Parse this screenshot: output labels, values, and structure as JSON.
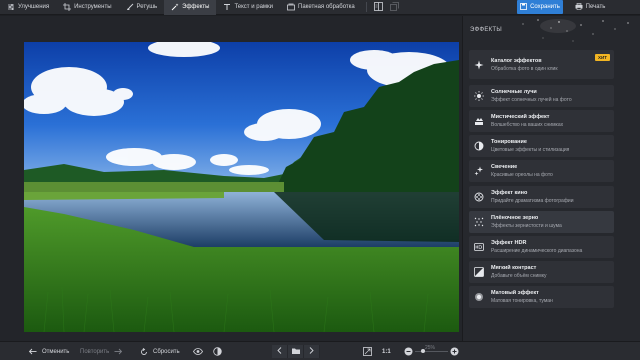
{
  "toolbar": {
    "tabs": [
      {
        "label": "Улучшения",
        "icon": "sliders-icon"
      },
      {
        "label": "Инструменты",
        "icon": "crop-icon"
      },
      {
        "label": "Ретушь",
        "icon": "brush-icon"
      },
      {
        "label": "Эффекты",
        "icon": "magic-wand-icon",
        "active": true
      },
      {
        "label": "Текст и рамки",
        "icon": "text-icon"
      },
      {
        "label": "Пакетная обработка",
        "icon": "batch-icon"
      }
    ],
    "save_label": "Сохранить",
    "print_label": "Печать"
  },
  "panel": {
    "title": "ЭФФЕКТЫ",
    "catalog": {
      "title": "Каталог эффектов",
      "subtitle": "Обработка фото в один клик",
      "badge": "ХИТ",
      "icon": "sparkle-icon"
    },
    "effects": [
      {
        "title": "Солнечные лучи",
        "subtitle": "Эффект солнечных лучей на фото",
        "icon": "sun-icon"
      },
      {
        "title": "Мистический эффект",
        "subtitle": "Волшебство на ваших снимках",
        "icon": "mystic-icon"
      },
      {
        "title": "Тонирование",
        "subtitle": "Цветовые эффекты и стилизация",
        "icon": "toning-icon"
      },
      {
        "title": "Свечение",
        "subtitle": "Красивые ореолы на фото",
        "icon": "glow-icon"
      },
      {
        "title": "Эффект кино",
        "subtitle": "Придайте драматизма фотографии",
        "icon": "film-icon"
      },
      {
        "title": "Плёночное зерно",
        "subtitle": "Эффекты зернистости и шума",
        "icon": "grain-icon"
      },
      {
        "title": "Эффект HDR",
        "subtitle": "Расширение динамического диапазона",
        "icon": "hdr-icon"
      },
      {
        "title": "Мягкий контраст",
        "subtitle": "Добавьте объём снимку",
        "icon": "contrast-icon"
      },
      {
        "title": "Матовый эффект",
        "subtitle": "Матовая тонировка, туман",
        "icon": "matte-icon"
      }
    ]
  },
  "bottom": {
    "undo_label": "Отменить",
    "redo_label": "Повторить",
    "reset_label": "Сбросить",
    "ratio_label": "1:1",
    "zoom_value": "25%"
  },
  "colors": {
    "accent": "#2f7fd6",
    "badge": "#f2b523",
    "panel": "#26282d",
    "toolbar": "#2a2c31"
  }
}
